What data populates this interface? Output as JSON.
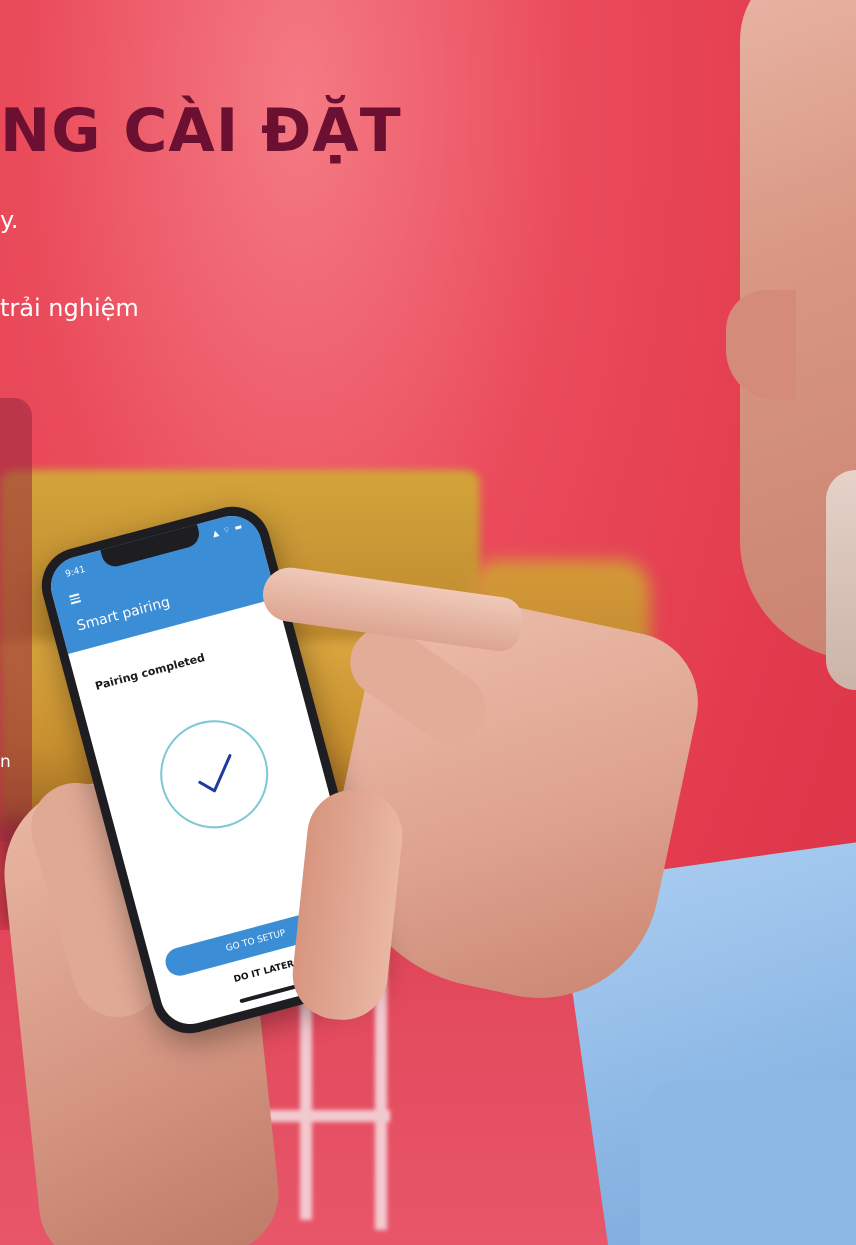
{
  "headline": "NG CÀI ĐẶT",
  "body_line_1": "y.",
  "body_line_2": "trải nghiệm",
  "card_text": "n",
  "phone": {
    "status_time": "9:41",
    "status_icons": "▲ ⌔ ▬",
    "app_title": "Smart pairing",
    "pairing_status": "Pairing completed",
    "primary_button": "GO TO SETUP",
    "secondary_button": "DO IT LATER"
  },
  "colors": {
    "background": "#e8404f",
    "headline": "#6b1030",
    "app_accent": "#3b8ed6",
    "check_ring": "#7cc8d6",
    "check_mark": "#1f3aa0"
  }
}
